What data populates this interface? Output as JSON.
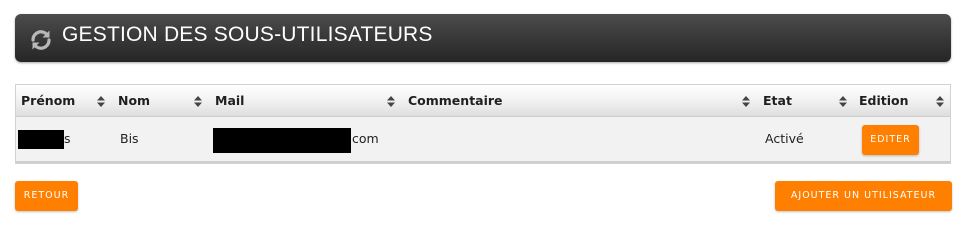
{
  "header": {
    "title": "GESTION DES SOUS-UTILISATEURS",
    "icon": "refresh-icon"
  },
  "table": {
    "columns": [
      {
        "label": "Prénom"
      },
      {
        "label": "Nom"
      },
      {
        "label": "Mail"
      },
      {
        "label": "Commentaire"
      },
      {
        "label": "Etat"
      },
      {
        "label": "Edition"
      }
    ],
    "rows": [
      {
        "prenom_suffix": "s",
        "nom": "Bis",
        "mail_suffix": "com",
        "commentaire": "",
        "etat": "Activé",
        "edit_label": "EDITER"
      }
    ]
  },
  "actions": {
    "back_label": "RETOUR",
    "add_user_label": "AJOUTER UN UTILISATEUR"
  },
  "colors": {
    "accent": "#ff7f00",
    "header_bg": "#333333"
  }
}
